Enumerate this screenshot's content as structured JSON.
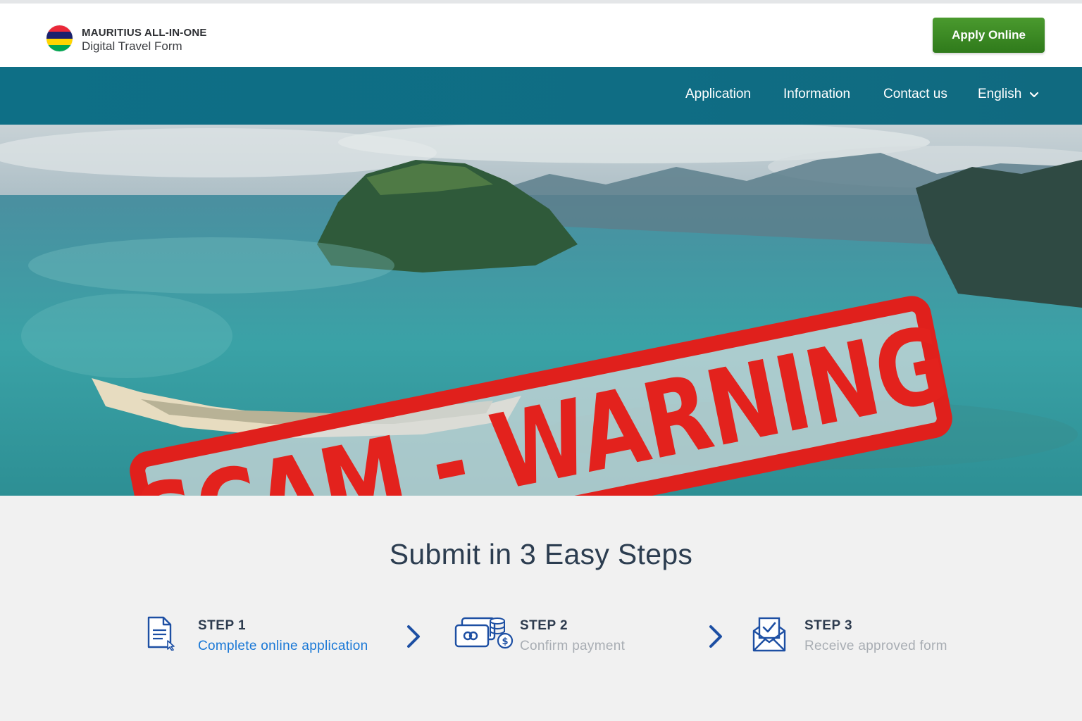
{
  "header": {
    "brand_title": "MAURITIUS ALL-IN-ONE",
    "brand_subtitle": "Digital Travel Form",
    "apply_label": "Apply Online",
    "flag_colors": [
      "#ea2839",
      "#1a206d",
      "#ffd500",
      "#00a551"
    ]
  },
  "nav": {
    "items": [
      {
        "label": "Application"
      },
      {
        "label": "Information"
      },
      {
        "label": "Contact us"
      }
    ],
    "language": "English"
  },
  "hero": {
    "stamp_text": "SCAM - WARNING",
    "stamp_color": "#e3221d"
  },
  "steps_section": {
    "title": "Submit in 3 Easy Steps",
    "steps": [
      {
        "label": "STEP 1",
        "description": "Complete online application",
        "icon": "document-form-icon"
      },
      {
        "label": "STEP 2",
        "description": "Confirm payment",
        "icon": "payment-card-coins-icon"
      },
      {
        "label": "STEP 3",
        "description": "Receive approved form",
        "icon": "envelope-check-icon"
      }
    ]
  },
  "colors": {
    "nav_bg": "#0f6d84",
    "apply_button": "#3d8c25",
    "active_step_link": "#1877d6",
    "icon_blue": "#1d4fa3"
  }
}
